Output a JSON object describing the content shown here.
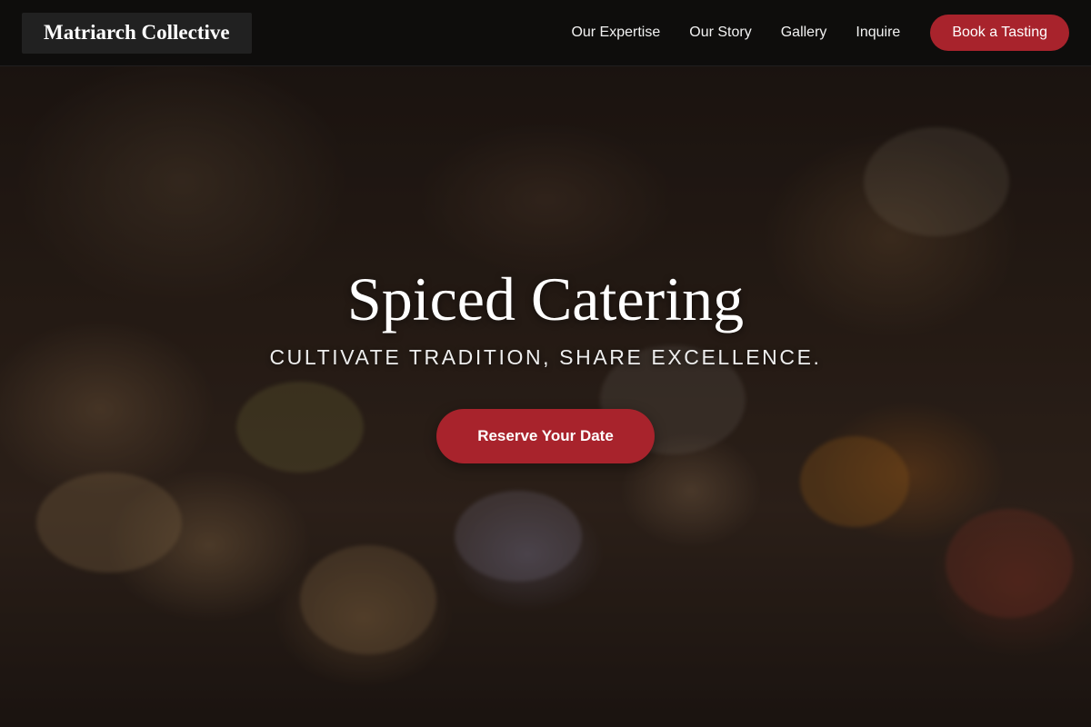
{
  "header": {
    "brand": "Matriarch Collective",
    "nav_items": [
      {
        "label": "Our Expertise"
      },
      {
        "label": "Our Story"
      },
      {
        "label": "Gallery"
      },
      {
        "label": "Inquire"
      }
    ],
    "cta_label": "Book a Tasting"
  },
  "hero": {
    "title": "Spiced Catering",
    "tagline": "CULTIVATE TRADITION, SHARE EXCELLENCE.",
    "cta_label": "Reserve Your Date",
    "background_image": "catering-appetizer-platter-photo"
  },
  "colors": {
    "accent": "#a8232c",
    "nav_background": "#0c0c0c",
    "text": "#ffffff"
  }
}
